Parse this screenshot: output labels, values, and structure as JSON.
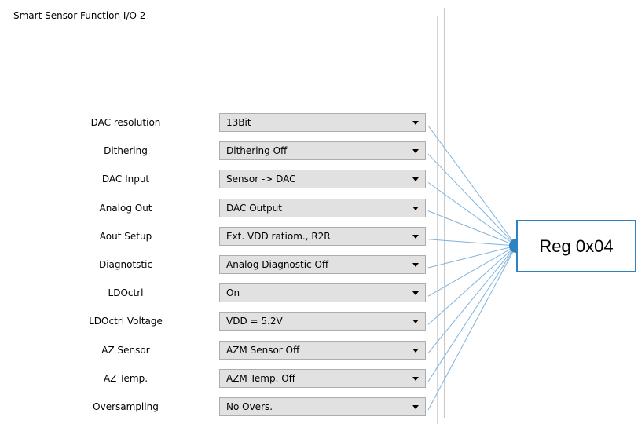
{
  "group": {
    "title": "Smart Sensor Function I/O 2"
  },
  "rows": [
    {
      "label": "DAC resolution",
      "value": "13Bit"
    },
    {
      "label": "Dithering",
      "value": "Dithering Off"
    },
    {
      "label": "DAC Input",
      "value": "Sensor -> DAC"
    },
    {
      "label": "Analog Out",
      "value": "DAC Output"
    },
    {
      "label": "Aout Setup",
      "value": "Ext. VDD ratiom., R2R"
    },
    {
      "label": "Diagnotstic",
      "value": "Analog Diagnostic Off"
    },
    {
      "label": "LDOctrl",
      "value": "On"
    },
    {
      "label": "LDOctrl Voltage",
      "value": "VDD = 5.2V"
    },
    {
      "label": "AZ Sensor",
      "value": "AZM Sensor Off"
    },
    {
      "label": "AZ Temp.",
      "value": "AZM Temp. Off"
    },
    {
      "label": "Oversampling",
      "value": "No Overs."
    }
  ],
  "callout": {
    "label": "Reg 0x04",
    "color": "#2e82c0",
    "line_color": "#7fb3dc"
  }
}
